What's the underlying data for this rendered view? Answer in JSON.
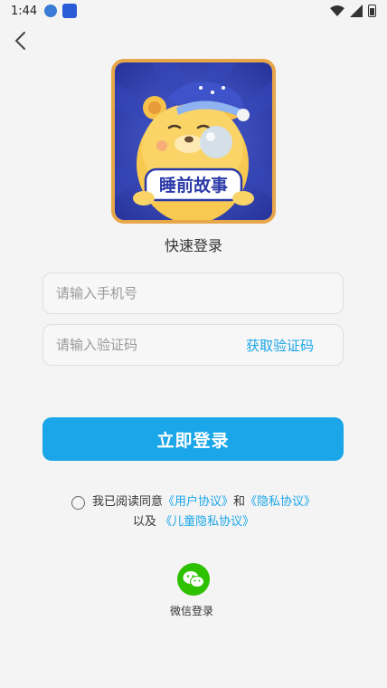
{
  "status_bar": {
    "time": "1:44"
  },
  "app_logo": {
    "text": "睡前故事"
  },
  "title": "快速登录",
  "phone_input": {
    "placeholder": "请输入手机号"
  },
  "code_input": {
    "placeholder": "请输入验证码"
  },
  "get_code": "获取验证码",
  "login_button": "立即登录",
  "agreement": {
    "prefix": "我已阅读同意",
    "user_agreement": "《用户协议》",
    "and": "和",
    "privacy_policy": "《隐私协议》",
    "and_also": "以及",
    "child_privacy": "《儿童隐私协议》"
  },
  "wechat": {
    "label": "微信登录"
  },
  "colors": {
    "accent": "#1aa6e8",
    "wechat": "#2dc100",
    "logo_bg": "#2c3aa8"
  }
}
